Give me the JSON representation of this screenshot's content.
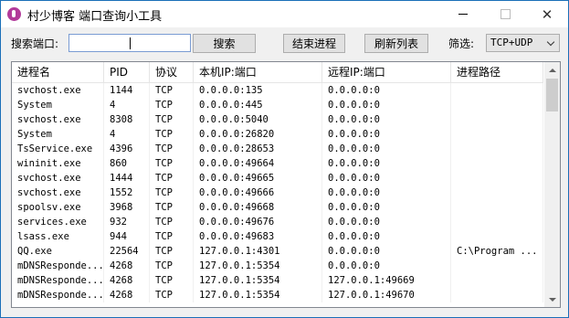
{
  "window": {
    "title": "村少博客 端口查询小工具",
    "close_glyph": "✕"
  },
  "toolbar": {
    "search_label": "搜索端口:",
    "search_value": "",
    "search_button": "搜索",
    "end_process_button": "结束进程",
    "refresh_button": "刷新列表",
    "filter_label": "筛选:",
    "filter_selected": "TCP+UDP"
  },
  "table": {
    "columns": [
      "进程名",
      "PID",
      "协议",
      "本机IP:端口",
      "远程IP:端口",
      "进程路径"
    ],
    "rows": [
      [
        "svchost.exe",
        "1144",
        "TCP",
        "0.0.0.0:135",
        "0.0.0.0:0",
        ""
      ],
      [
        "System",
        "4",
        "TCP",
        "0.0.0.0:445",
        "0.0.0.0:0",
        ""
      ],
      [
        "svchost.exe",
        "8308",
        "TCP",
        "0.0.0.0:5040",
        "0.0.0.0:0",
        ""
      ],
      [
        "System",
        "4",
        "TCP",
        "0.0.0.0:26820",
        "0.0.0.0:0",
        ""
      ],
      [
        "TsService.exe",
        "4396",
        "TCP",
        "0.0.0.0:28653",
        "0.0.0.0:0",
        ""
      ],
      [
        "wininit.exe",
        "860",
        "TCP",
        "0.0.0.0:49664",
        "0.0.0.0:0",
        ""
      ],
      [
        "svchost.exe",
        "1444",
        "TCP",
        "0.0.0.0:49665",
        "0.0.0.0:0",
        ""
      ],
      [
        "svchost.exe",
        "1552",
        "TCP",
        "0.0.0.0:49666",
        "0.0.0.0:0",
        ""
      ],
      [
        "spoolsv.exe",
        "3968",
        "TCP",
        "0.0.0.0:49668",
        "0.0.0.0:0",
        ""
      ],
      [
        "services.exe",
        "932",
        "TCP",
        "0.0.0.0:49676",
        "0.0.0.0:0",
        ""
      ],
      [
        "lsass.exe",
        "944",
        "TCP",
        "0.0.0.0:49683",
        "0.0.0.0:0",
        ""
      ],
      [
        "QQ.exe",
        "22564",
        "TCP",
        "127.0.0.1:4301",
        "0.0.0.0:0",
        "C:\\Program ..."
      ],
      [
        "mDNSResponde...",
        "4268",
        "TCP",
        "127.0.0.1:5354",
        "0.0.0.0:0",
        ""
      ],
      [
        "mDNSResponde...",
        "4268",
        "TCP",
        "127.0.0.1:5354",
        "127.0.0.1:49669",
        ""
      ],
      [
        "mDNSResponde...",
        "4268",
        "TCP",
        "127.0.0.1:5354",
        "127.0.0.1:49670",
        ""
      ]
    ]
  }
}
